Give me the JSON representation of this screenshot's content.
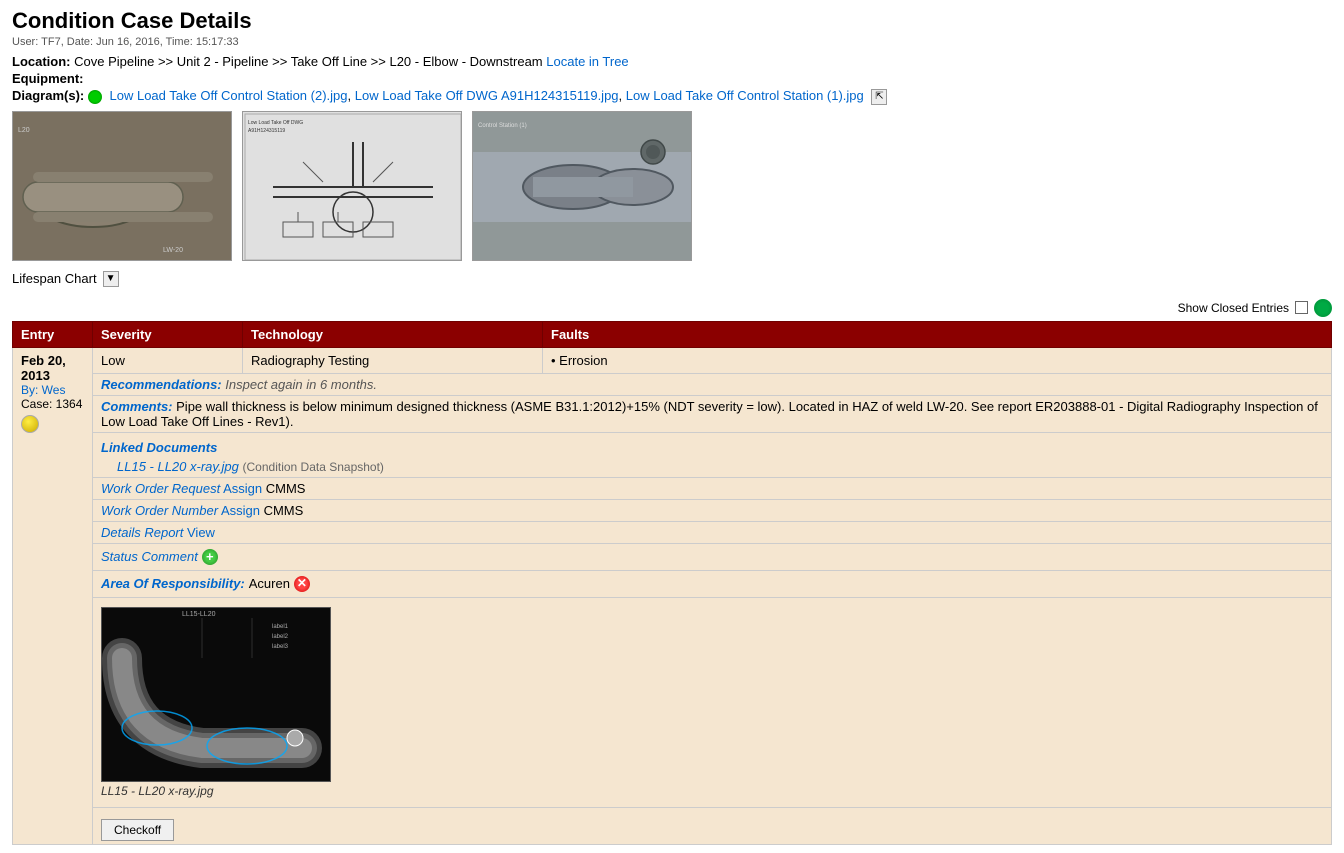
{
  "page": {
    "title": "Condition Case Details",
    "user_info": "User: TF7, Date: Jun 16, 2016, Time: 15:17:33"
  },
  "location": {
    "label": "Location:",
    "path": "Cove Pipeline >> Unit 2 - Pipeline >> Take Off Line >> L20 - Elbow - Downstream",
    "locate_link": "Locate in Tree",
    "equipment_label": "Equipment:",
    "equipment_value": ""
  },
  "diagrams": {
    "label": "Diagram(s):",
    "files": [
      "Low Load Take Off Control Station (2).jpg",
      "Low Load Take Off DWG A91H124315119.jpg",
      "Low Load Take Off Control Station (1).jpg"
    ]
  },
  "lifespan": {
    "label": "Lifespan Chart",
    "expand_symbol": "▼"
  },
  "show_closed": {
    "label": "Show Closed Entries"
  },
  "table": {
    "headers": {
      "entry": "Entry",
      "severity": "Severity",
      "technology": "Technology",
      "faults": "Faults"
    },
    "rows": [
      {
        "entry_date": "Feb 20, 2013",
        "by": "By: Wes",
        "case": "Case: 1364",
        "severity": "Low",
        "technology": "Radiography Testing",
        "faults": "• Errosion",
        "recommendations_label": "Recommendations:",
        "recommendations": "Inspect again in 6 months.",
        "comments_label": "Comments:",
        "comments": "Pipe wall thickness is below minimum designed thickness (ASME B31.1:2012)+15% (NDT severity = low). Located in HAZ of weld LW-20. See report ER203888-01 - Digital Radiography Inspection of Low Load Take Off Lines - Rev1).",
        "linked_docs_title": "Linked Documents",
        "linked_doc_file": "LL15 - LL20 x-ray.jpg",
        "linked_doc_note": "(Condition Data Snapshot)",
        "work_order_request_label": "Work Order Request",
        "assign_label": "Assign",
        "cmms1": "CMMS",
        "work_order_number_label": "Work Order Number",
        "assign_label2": "Assign",
        "cmms2": "CMMS",
        "details_report_label": "Details Report",
        "view_label": "View",
        "status_comment_label": "Status Comment",
        "area_of_resp_label": "Area Of Responsibility:",
        "area_of_resp_value": "Acuren",
        "xray_image_label": "LL15 - LL20 x-ray.jpg",
        "checkoff_btn": "Checkoff"
      }
    ]
  }
}
